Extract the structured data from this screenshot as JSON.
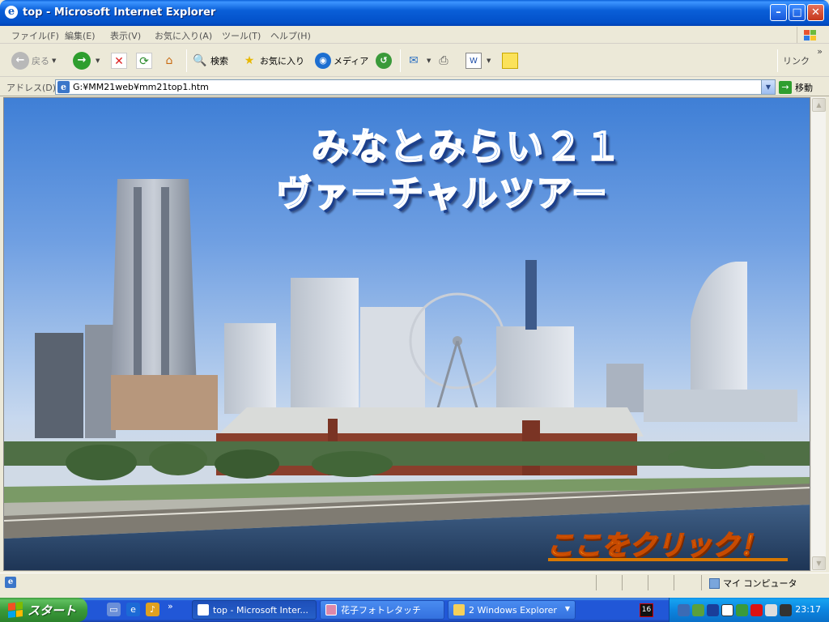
{
  "window": {
    "title": "top - Microsoft Internet Explorer"
  },
  "menu": [
    "ファイル(F)",
    "編集(E)",
    "表示(V)",
    "お気に入り(A)",
    "ツール(T)",
    "ヘルプ(H)"
  ],
  "toolbar": {
    "back": "戻る",
    "search": "検索",
    "favorites": "お気に入り",
    "media": "メディア",
    "links": "リンク",
    "chevron": "»"
  },
  "address": {
    "label": "アドレス(D)",
    "value": "G:¥MM21web¥mm21top1.htm",
    "go": "移動"
  },
  "page": {
    "heading_line1": "みなとみらい２１",
    "heading_line2": "ヴァーチャルツアー",
    "click_link": "ここをクリック！"
  },
  "status": {
    "zone": "マイ コンピュータ"
  },
  "taskbar": {
    "start": "スタート",
    "quicklaunch_chevron": "»",
    "tasks": [
      {
        "label": "top - Microsoft Inter..."
      },
      {
        "label": "花子フォトレタッチ"
      },
      {
        "label": "2 Windows Explorer"
      }
    ],
    "tray_badge": "16",
    "clock": "23:17"
  },
  "colors": {
    "titlebar": "#0a5fd8",
    "heading": "#2a78e8",
    "link": "#ffa31a",
    "taskbar": "#2157d7",
    "start": "#3a9a3a"
  }
}
